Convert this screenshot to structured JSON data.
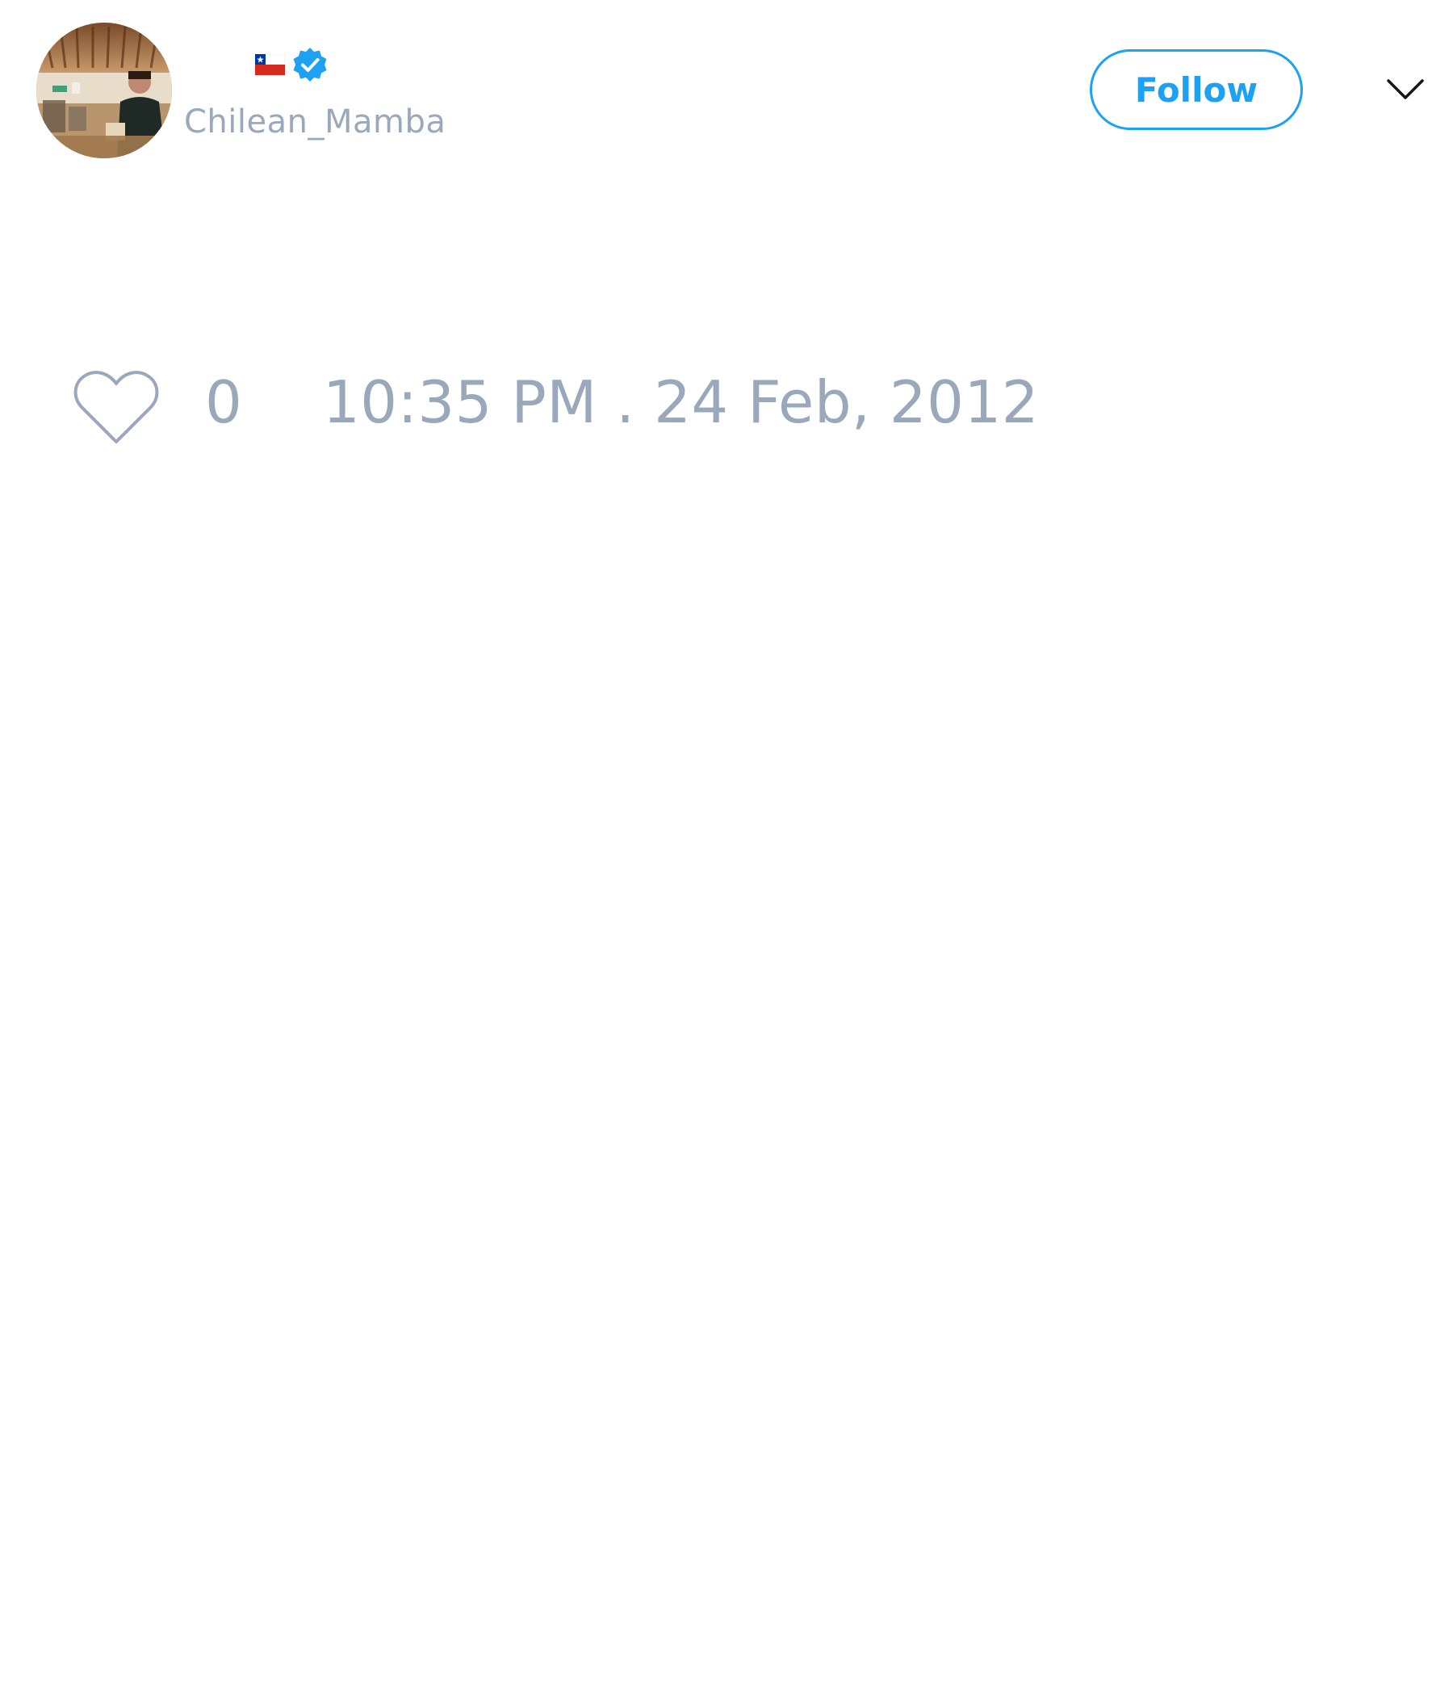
{
  "tweet": {
    "author": {
      "handle": "Chilean_Mamba",
      "flag_icon": "chile-flag-icon",
      "verified_icon": "verified-badge-icon",
      "verified_color": "#1da1f2"
    },
    "follow_label": "Follow",
    "menu_icon": "chevron-down-icon",
    "likes": {
      "icon": "heart-icon",
      "count": "0"
    },
    "timestamp": "10:35 PM . 24 Feb, 2012"
  },
  "colors": {
    "accent": "#1da1f2",
    "muted_text": "#99a8bb",
    "background": "#ffffff"
  }
}
